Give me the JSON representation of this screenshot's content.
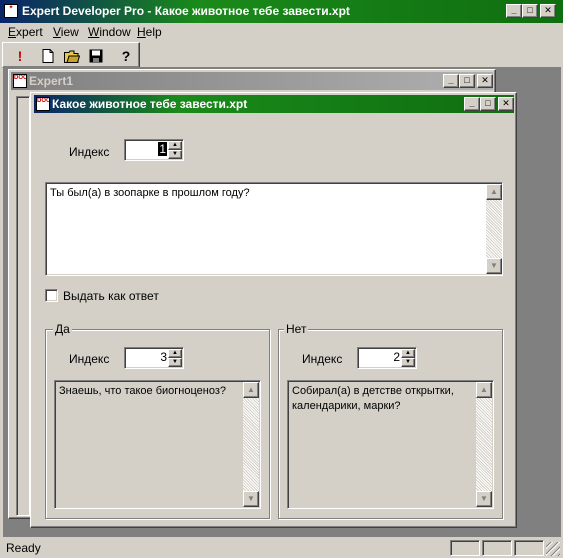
{
  "app": {
    "title": "Expert Developer Pro - Какое животное тебе завести.xpt",
    "menu": [
      "Expert",
      "View",
      "Window",
      "Help"
    ],
    "toolbar": {
      "run_icon": "exclamation-icon",
      "new_icon": "new-document-icon",
      "open_icon": "open-folder-icon",
      "save_icon": "floppy-disk-icon",
      "help_icon": "question-mark-icon"
    }
  },
  "bg_window": {
    "title": "Expert1"
  },
  "fg_window": {
    "title": "Какое животное тебе завести.xpt",
    "index_label": "Индекс",
    "index_value": "1",
    "question_text": "Ты был(а) в зоопарке в прошлом году?",
    "as_answer_label": "Выдать как ответ",
    "as_answer_checked": false,
    "yes_group": {
      "title": "Да",
      "index_label": "Индекс",
      "index_value": "3",
      "text": "Знаешь, что такое биогноценоз?"
    },
    "no_group": {
      "title": "Нет",
      "index_label": "Индекс",
      "index_value": "2",
      "text": "Собирал(а) в детстве открытки, календарики, марки?"
    }
  },
  "status": {
    "text": "Ready"
  },
  "colors": {
    "title_active": "#0f6e0f",
    "title_inactive": "#808080",
    "face": "#d4d0c8"
  }
}
